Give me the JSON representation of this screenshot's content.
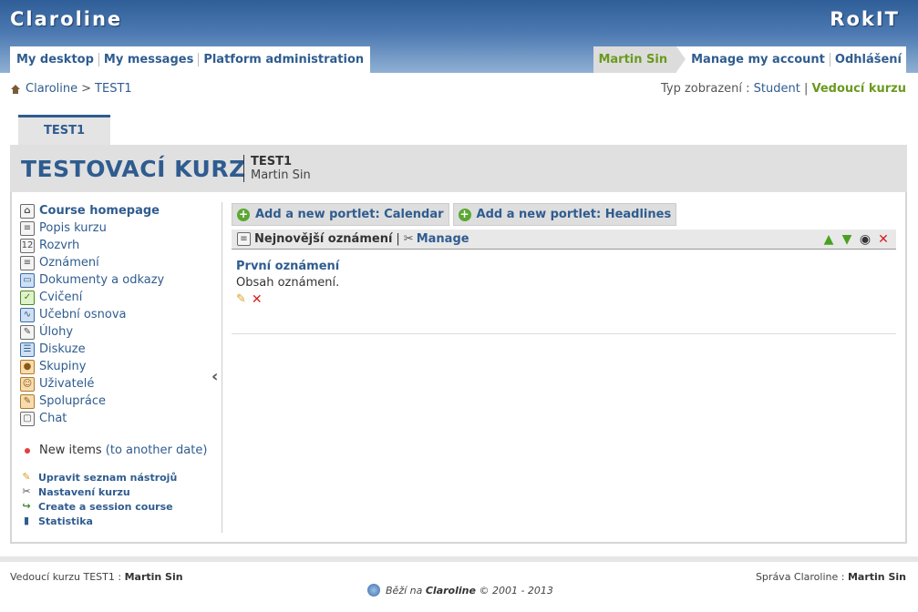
{
  "header": {
    "campus": "Claroline",
    "institution": "RokIT",
    "nav_left": [
      "My desktop",
      "My messages",
      "Platform administration"
    ],
    "user": "Martin Sin",
    "nav_right": [
      "Manage my account",
      "Odhlášení"
    ]
  },
  "breadcrumb": {
    "root": "Claroline",
    "sep": ">",
    "current": "TEST1"
  },
  "viewmode": {
    "label": "Typ zobrazení :",
    "student": "Student",
    "sep": "|",
    "teacher": "Vedoucí kurzu"
  },
  "course": {
    "tab": "TEST1",
    "title": "TESTOVACÍ KURZ",
    "code": "TEST1",
    "teacher": "Martin Sin"
  },
  "tools": [
    {
      "label": "Course homepage",
      "icon": "home-page-icon"
    },
    {
      "label": "Popis kurzu",
      "icon": "description-icon"
    },
    {
      "label": "Rozvrh",
      "icon": "calendar-icon"
    },
    {
      "label": "Oznámení",
      "icon": "announcement-icon"
    },
    {
      "label": "Dokumenty a odkazy",
      "icon": "folder-icon"
    },
    {
      "label": "Cvičení",
      "icon": "exercise-icon"
    },
    {
      "label": "Učební osnova",
      "icon": "learnpath-icon"
    },
    {
      "label": "Úlohy",
      "icon": "assignment-icon"
    },
    {
      "label": "Diskuze",
      "icon": "forum-icon"
    },
    {
      "label": "Skupiny",
      "icon": "groups-icon"
    },
    {
      "label": "Uživatelé",
      "icon": "users-icon"
    },
    {
      "label": "Spolupráce",
      "icon": "wiki-icon"
    },
    {
      "label": "Chat",
      "icon": "chat-icon"
    }
  ],
  "new_items": {
    "label": "New items",
    "link": "(to another date)"
  },
  "admin_tools": [
    {
      "label": "Upravit seznam nástrojů",
      "icon": "pencil-icon"
    },
    {
      "label": "Nastavení kurzu",
      "icon": "tools-icon"
    },
    {
      "label": "Create a session course",
      "icon": "session-icon"
    },
    {
      "label": "Statistika",
      "icon": "statistics-icon"
    }
  ],
  "portlets": {
    "add_calendar": "Add a new portlet: Calendar",
    "add_headlines": "Add a new portlet: Headlines",
    "title": "Nejnovější oznámení",
    "sep": "|",
    "manage": "Manage"
  },
  "announcement": {
    "title": "První oznámení",
    "body": "Obsah oznámení."
  },
  "footer": {
    "left_label": "Vedoucí kurzu TEST1 :",
    "left_name": "Martin Sin",
    "right_label": "Správa Claroline :",
    "right_name": "Martin Sin",
    "powered_prefix": "Běží na",
    "powered_name": "Claroline",
    "powered_suffix": "© 2001 - 2013"
  },
  "colors": {
    "accent": "#2f5c8f",
    "active_green": "#6a9a1f",
    "delete_red": "#d81e1e"
  }
}
